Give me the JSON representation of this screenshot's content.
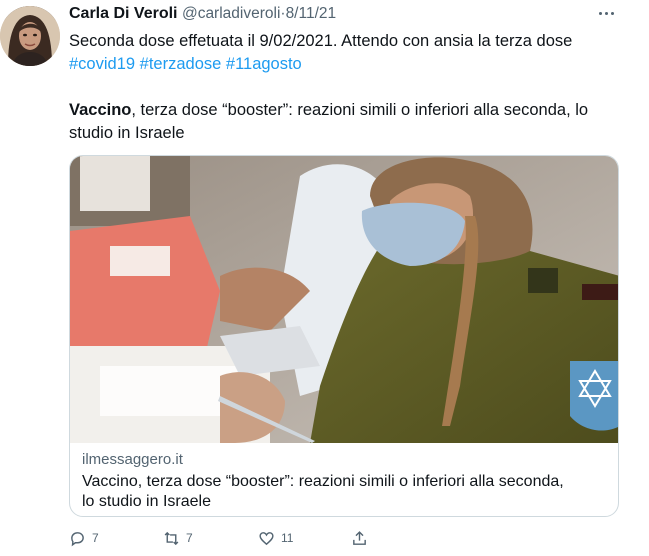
{
  "tweet": {
    "author_name": "Carla Di Veroli",
    "handle": "@carladiveroli",
    "separator": "·",
    "date": "8/11/21",
    "text_line1": "Seconda dose effetuata il 9/02/2021. Attendo con ansia la terza dose",
    "hashtags": [
      "#covid19",
      "#terzadose",
      "#11agosto"
    ],
    "quote_bold": "Vaccino",
    "quote_rest_line1": ", terza dose “booster”: reazioni simili o inferiori alla seconda, lo",
    "quote_line2": "studio in Israele"
  },
  "card": {
    "domain": "ilmessaggero.it",
    "title_line1": "Vaccino, terza dose “booster”: reazioni simili o inferiori alla seconda,",
    "title_line2": "lo studio in Israele"
  },
  "actions": {
    "replies": "7",
    "retweets": "7",
    "likes": "11"
  },
  "icons": [
    "more-icon",
    "reply-icon",
    "retweet-icon",
    "like-icon",
    "share-icon"
  ],
  "colors": {
    "link": "#1d9bf0",
    "secondary": "#536471",
    "text": "#0f1419",
    "border": "#cfd9de"
  }
}
